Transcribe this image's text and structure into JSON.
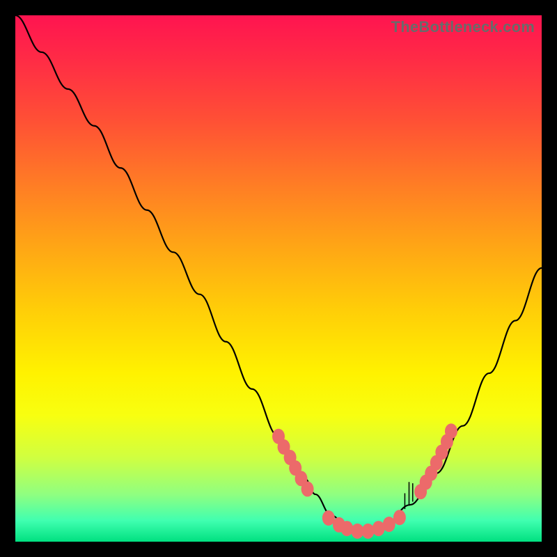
{
  "watermark": "TheBottleneck.com",
  "chart_data": {
    "type": "line",
    "title": "",
    "xlabel": "",
    "ylabel": "",
    "xlim": [
      0,
      100
    ],
    "ylim": [
      0,
      100
    ],
    "series": [
      {
        "name": "curve",
        "x": [
          0,
          5,
          10,
          15,
          20,
          25,
          30,
          35,
          40,
          45,
          50,
          55,
          57,
          60,
          63,
          65,
          68,
          70,
          75,
          80,
          85,
          90,
          95,
          100
        ],
        "y": [
          100,
          93,
          86,
          79,
          71,
          63,
          55,
          47,
          38,
          29,
          20,
          12,
          9,
          5,
          3,
          2,
          2,
          3,
          7,
          13,
          22,
          32,
          42,
          52
        ]
      }
    ],
    "markers": [
      {
        "group": "left-cluster",
        "points": [
          {
            "x": 50.0,
            "y": 20.0
          },
          {
            "x": 51.0,
            "y": 18.0
          },
          {
            "x": 52.2,
            "y": 16.0
          },
          {
            "x": 53.2,
            "y": 14.0
          },
          {
            "x": 54.3,
            "y": 12.0
          },
          {
            "x": 55.5,
            "y": 10.0
          }
        ]
      },
      {
        "group": "valley-cluster",
        "points": [
          {
            "x": 59.5,
            "y": 4.5
          },
          {
            "x": 61.5,
            "y": 3.2
          },
          {
            "x": 63.0,
            "y": 2.5
          },
          {
            "x": 65.0,
            "y": 2.0
          },
          {
            "x": 67.0,
            "y": 2.0
          },
          {
            "x": 69.0,
            "y": 2.5
          },
          {
            "x": 71.0,
            "y": 3.3
          },
          {
            "x": 73.0,
            "y": 4.6
          }
        ]
      },
      {
        "group": "right-cluster",
        "points": [
          {
            "x": 77.0,
            "y": 9.5
          },
          {
            "x": 78.0,
            "y": 11.3
          },
          {
            "x": 79.0,
            "y": 13.0
          },
          {
            "x": 80.0,
            "y": 15.0
          },
          {
            "x": 81.0,
            "y": 17.0
          },
          {
            "x": 82.0,
            "y": 19.0
          },
          {
            "x": 82.8,
            "y": 21.0
          }
        ]
      }
    ],
    "spikes": [
      {
        "x": 74.0,
        "height": 3.0
      },
      {
        "x": 74.8,
        "height": 4.5
      },
      {
        "x": 75.5,
        "height": 3.5
      }
    ],
    "colors": {
      "curve_stroke": "#000000",
      "marker_fill": "#ec6a6a",
      "gradient_top": "#ff1450",
      "gradient_bottom": "#00e080"
    }
  }
}
